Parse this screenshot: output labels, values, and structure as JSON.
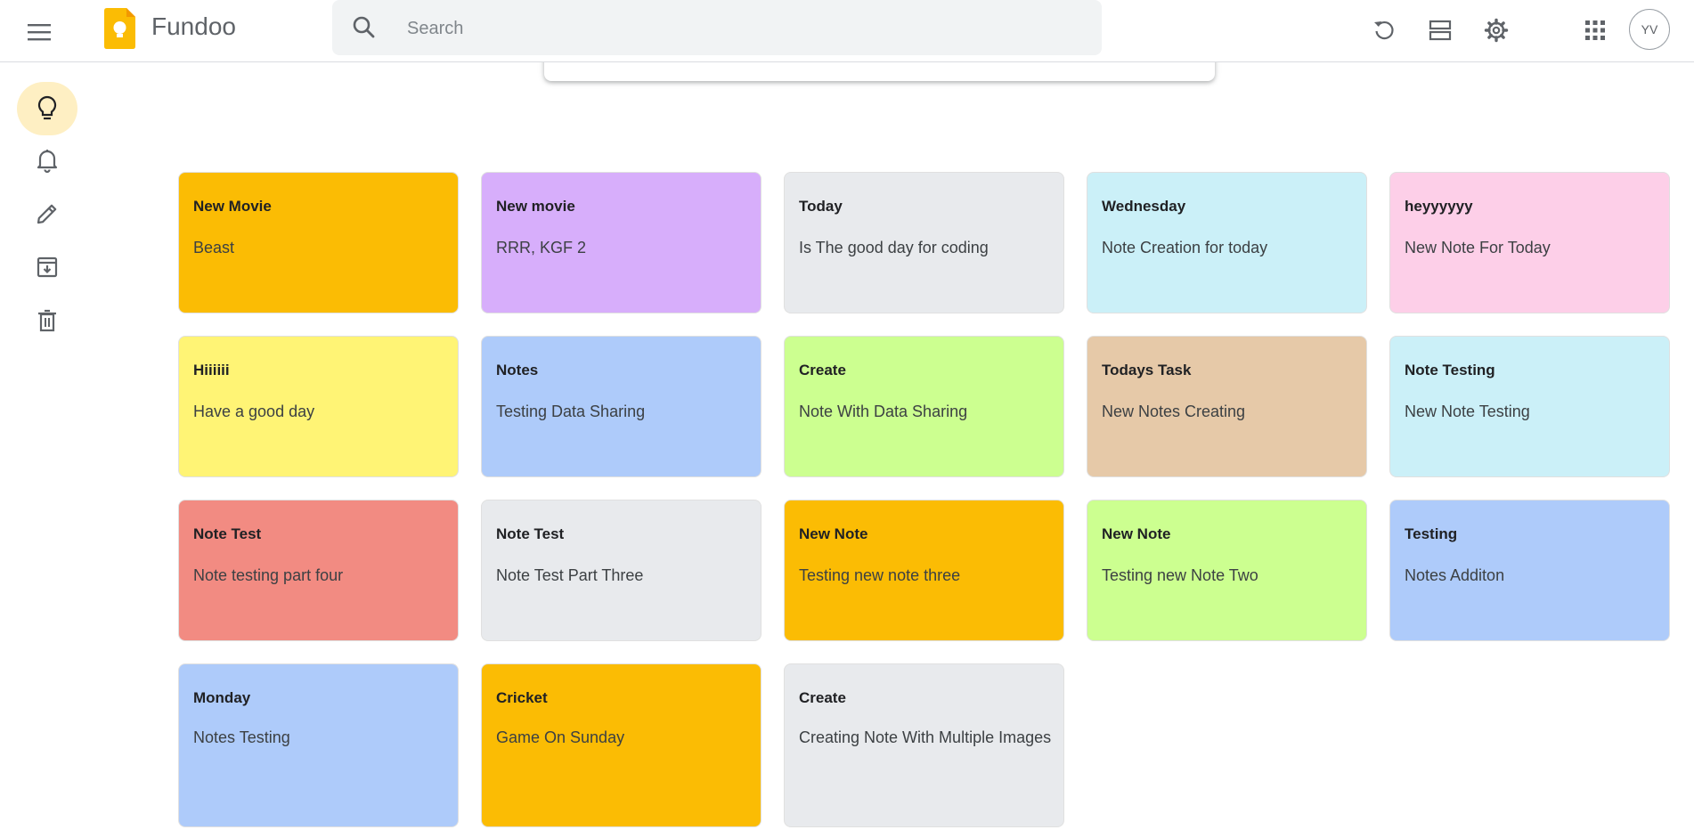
{
  "header": {
    "app_title": "Fundoo",
    "search_placeholder": "Search",
    "search_value": "",
    "avatar_initials": "YV"
  },
  "sidebar": {
    "items": [
      {
        "name": "notes",
        "icon": "lightbulb-icon",
        "active": true
      },
      {
        "name": "reminders",
        "icon": "bell-icon",
        "active": false
      },
      {
        "name": "edit-labels",
        "icon": "pencil-icon",
        "active": false
      },
      {
        "name": "archive",
        "icon": "archive-icon",
        "active": false
      },
      {
        "name": "trash",
        "icon": "trash-icon",
        "active": false
      }
    ]
  },
  "notes": [
    {
      "title": "New Movie",
      "text": "Beast",
      "color": "#fbbc04"
    },
    {
      "title": "New movie",
      "text": "RRR, KGF 2",
      "color": "#d7aefb"
    },
    {
      "title": "Today",
      "text": "Is The good day for coding",
      "color": "#e8eaed"
    },
    {
      "title": "Wednesday",
      "text": "Note Creation for today",
      "color": "#cbf0f8"
    },
    {
      "title": "heyyyyyy",
      "text": "New Note For Today",
      "color": "#fdcfe8"
    },
    {
      "title": "Hiiiiii",
      "text": "Have a good day",
      "color": "#fff475"
    },
    {
      "title": "Notes",
      "text": "Testing Data Sharing",
      "color": "#aecbfa"
    },
    {
      "title": "Create",
      "text": "Note With Data Sharing",
      "color": "#ccff90"
    },
    {
      "title": "Todays Task",
      "text": "New Notes Creating",
      "color": "#e6c9a8"
    },
    {
      "title": "Note Testing",
      "text": "New Note Testing",
      "color": "#cbf0f8"
    },
    {
      "title": "Note Test",
      "text": "Note testing part four",
      "color": "#f28b82"
    },
    {
      "title": "Note Test",
      "text": "Note Test Part Three",
      "color": "#e8eaed"
    },
    {
      "title": "New Note",
      "text": "Testing new note three",
      "color": "#fbbc04"
    },
    {
      "title": "New Note",
      "text": "Testing new Note Two",
      "color": "#ccff90"
    },
    {
      "title": "Testing",
      "text": "Notes Additon",
      "color": "#aecbfa"
    },
    {
      "title": "Monday",
      "text": "Notes Testing",
      "color": "#aecbfa"
    },
    {
      "title": "Cricket",
      "text": "Game On Sunday",
      "color": "#fbbc04"
    },
    {
      "title": "Create",
      "text": "Creating Note With Multiple Images",
      "color": "#e8eaed"
    }
  ]
}
